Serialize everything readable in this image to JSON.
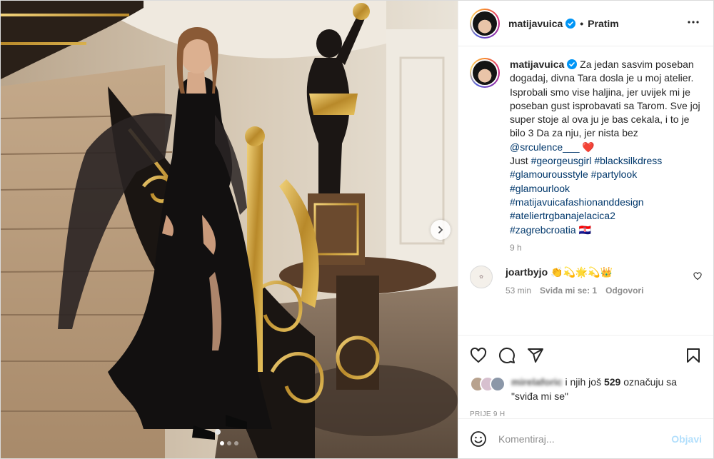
{
  "header": {
    "username": "matijavuica",
    "separator": "•",
    "follow_label": "Pratim",
    "more_label": "•••"
  },
  "caption": {
    "username": "matijavuica",
    "text": "Za jedan sasvim poseban dogadaj, divna Tara dosla je u moj atelier. Isprobali smo vise haljina, jer uvijek mi je poseban gust isprobavati sa Tarom. Sve joj super stoje al ova ju je bas cekala, i to je bilo 3 Da za nju, jer nista bez",
    "mention": "@srculence___",
    "mention_emoji": "❤️",
    "just_label": "Just",
    "hashtags": [
      "#georgeusgirl",
      "#blacksilkdress",
      "#glamourousstyle",
      "#partylook",
      "#glamourlook",
      "#matijavuicafashionanddesign",
      "#ateliertrgbanajelacica2",
      "#zagrebcroatia"
    ],
    "flag_emoji": "🇭🇷",
    "time": "9 h"
  },
  "comment": {
    "username": "joartbyjo",
    "emojis": "👏💫🌟💫👑",
    "time": "53 min",
    "likes_label": "Sviđa mi se: 1",
    "reply_label": "Odgovori"
  },
  "likes": {
    "blurred_name": "mirelaforic",
    "and_label": "i njih još",
    "count": "529",
    "suffix": "označuju sa \"sviđa mi se\""
  },
  "post_time": "PRIJE 9 H",
  "add_comment": {
    "placeholder": "Komentiraj...",
    "post_label": "Objavi"
  },
  "carousel": {
    "total": 3,
    "active": 1
  },
  "colors": {
    "link": "#00376b",
    "verified": "#0095f6",
    "post_button_disabled": "#b2dffc",
    "muted": "#8e8e8e"
  }
}
